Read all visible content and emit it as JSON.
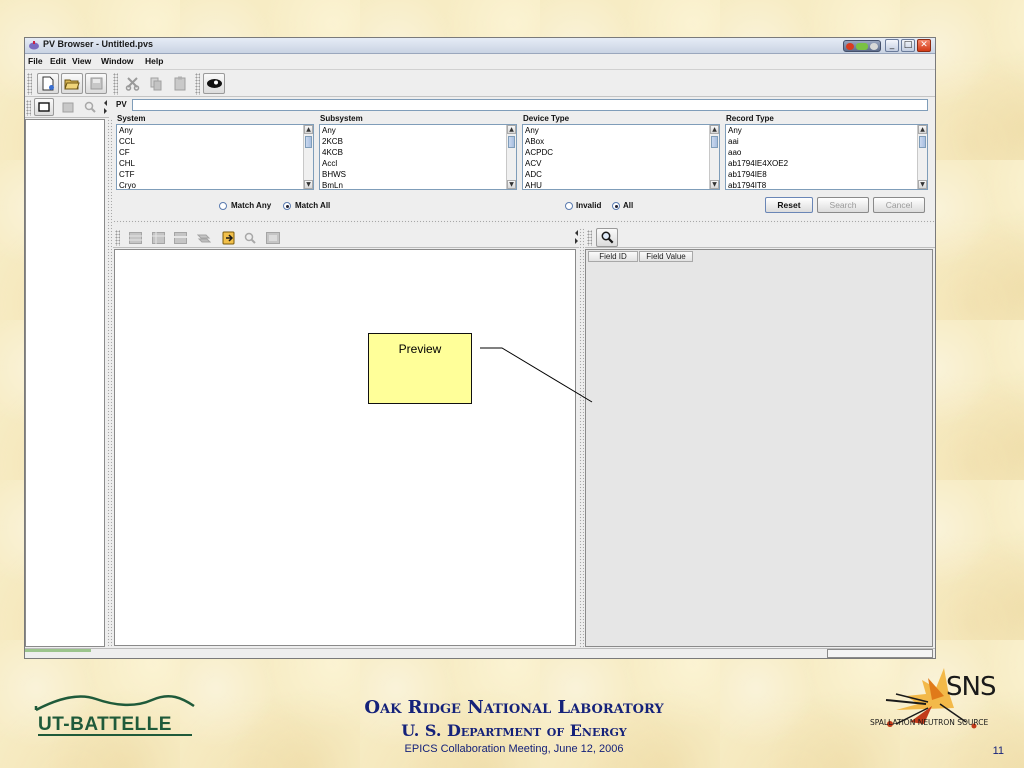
{
  "window": {
    "title": "PV Browser - Untitled.pvs",
    "menu": [
      "File",
      "Edit",
      "View",
      "Window",
      "Help"
    ]
  },
  "search": {
    "pv_label": "PV",
    "columns": [
      {
        "header": "System",
        "items": [
          "Any",
          "CCL",
          "CF",
          "CHL",
          "CTF",
          "Cryo"
        ]
      },
      {
        "header": "Subsystem",
        "items": [
          "Any",
          "2KCB",
          "4KCB",
          "Accl",
          "BHWS",
          "BmLn"
        ]
      },
      {
        "header": "Device Type",
        "items": [
          "Any",
          "ABox",
          "ACPDC",
          "ACV",
          "ADC",
          "AHU"
        ]
      },
      {
        "header": "Record Type",
        "items": [
          "Any",
          "aai",
          "aao",
          "ab1794IE4XOE2",
          "ab1794IE8",
          "ab1794IT8"
        ]
      }
    ],
    "match_any": "Match Any",
    "match_all": "Match All",
    "invalid": "Invalid",
    "all": "All",
    "reset": "Reset",
    "search_btn": "Search",
    "cancel": "Cancel"
  },
  "preview": {
    "field_id": "Field ID",
    "field_value": "Field Value"
  },
  "annotation": {
    "text": "Preview"
  },
  "footer": {
    "logo_left": "UT-BATTELLE",
    "lab": "Oak Ridge National Laboratory",
    "dept": "U. S. Department of Energy",
    "meeting": "EPICS Collaboration Meeting, June 12, 2006",
    "logo_right_big": "SNS",
    "logo_right_small": "SPALLATION NEUTRON SOURCE",
    "page": "11"
  },
  "colors": {
    "slide_bg": "#f7ecc4",
    "footer_text": "#15227a",
    "callout_fill": "#ffff99",
    "logo_green": "#1f5a3a",
    "sns_orange": "#e07a1a"
  }
}
